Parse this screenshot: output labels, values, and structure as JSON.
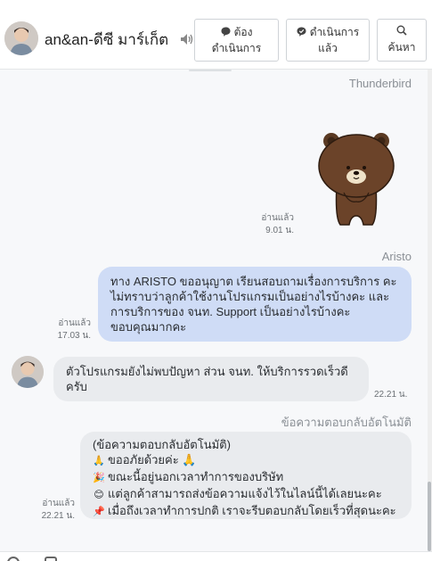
{
  "header": {
    "contact_name": "an&an-ดีซี มาร์เก็ต",
    "buttons": {
      "todo": {
        "line1": "ต้อง",
        "line2": "ดำเนินการ"
      },
      "done": {
        "line1": "ดำเนินการ",
        "line2": "แล้ว"
      },
      "search": {
        "label": "ค้นหา"
      }
    }
  },
  "messages": {
    "sticker_msg": {
      "sender": "Thunderbird",
      "read": "อ่านแล้ว",
      "time": "9.01 น."
    },
    "aristo_msg": {
      "sender": "Aristo",
      "lines": [
        "ทาง ARISTO ขออนุญาต เรียนสอบถามเรื่องการบริการ คะ",
        "ไม่ทราบว่าลูกค้าใช้งานโปรแกรมเป็นอย่างไรบ้างคะ และ",
        "การบริการของ จนท. Support เป็นอย่างไรบ้างคะ",
        "ขอบคุณมากคะ"
      ],
      "read": "อ่านแล้ว",
      "time": "17.03 น."
    },
    "customer_msg": {
      "lines": [
        "ตัวโปรแกรมยังไม่พบปัญหา ส่วน จนท. ให้บริการรวดเร็วดี",
        "ครับ"
      ],
      "time": "22.21 น."
    },
    "auto_msg": {
      "sender": "ข้อความตอบกลับอัตโนมัติ",
      "lines": [
        {
          "emoji": "",
          "text": "(ข้อความตอบกลับอัตโนมัติ)"
        },
        {
          "emoji": "🙏",
          "text": "ขออภัยด้วยค่ะ 🙏"
        },
        {
          "emoji": "🎉",
          "text": "ขณะนี้อยู่นอกเวลาทำการของบริษัท"
        },
        {
          "emoji": "😊",
          "text": "แต่ลูกค้าสามารถส่งข้อความแจ้งไว้ในไลน์นี้ได้เลยนะคะ"
        },
        {
          "emoji": "📌",
          "text": "เมื่อถึงเวลาทำการปกติ เราจะรีบตอบกลับโดยเร็วที่สุดนะคะ"
        }
      ],
      "read": "อ่านแล้ว",
      "time": "22.21 น."
    }
  },
  "colors": {
    "outgoing_bubble": "#cfdcf6",
    "incoming_bubble": "#e9ebee",
    "chat_background": "#f7f8fa"
  }
}
